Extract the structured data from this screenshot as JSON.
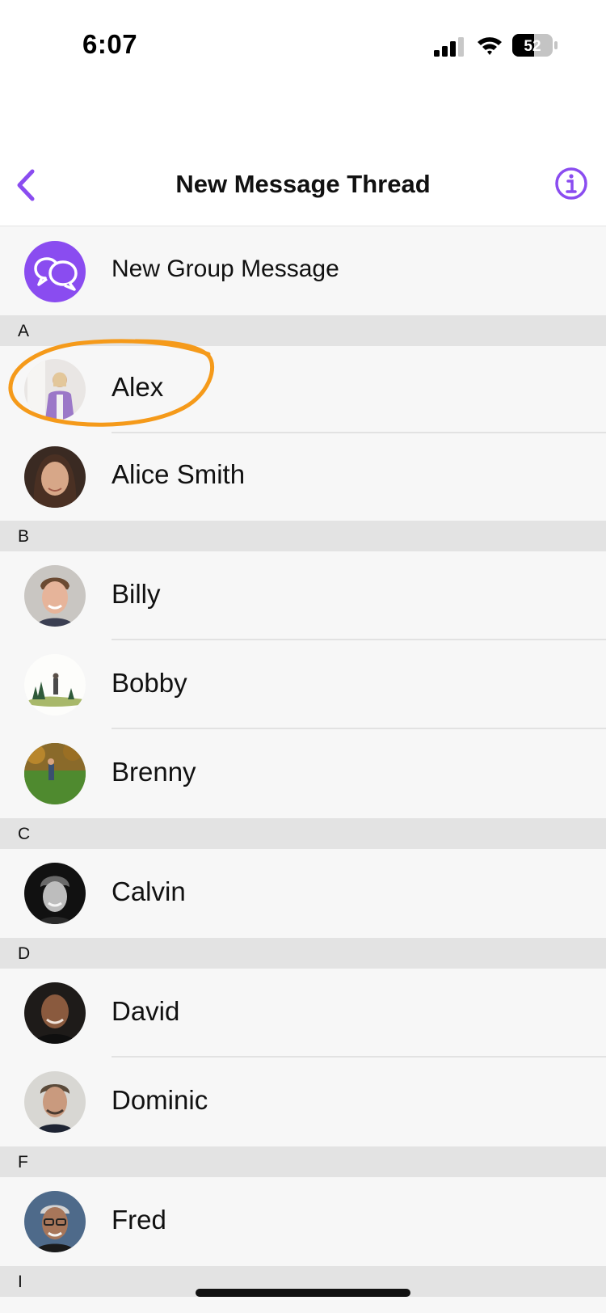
{
  "status_bar": {
    "time": "6:07",
    "battery": "52"
  },
  "nav": {
    "title": "New Message Thread"
  },
  "new_group": {
    "label": "New Group Message"
  },
  "sections": [
    {
      "letter": "A",
      "contacts": [
        "Alex",
        "Alice Smith"
      ]
    },
    {
      "letter": "B",
      "contacts": [
        "Billy",
        "Bobby",
        "Brenny"
      ]
    },
    {
      "letter": "C",
      "contacts": [
        "Calvin"
      ]
    },
    {
      "letter": "D",
      "contacts": [
        "David",
        "Dominic"
      ]
    },
    {
      "letter": "F",
      "contacts": [
        "Fred"
      ]
    },
    {
      "letter": "I",
      "contacts": []
    }
  ],
  "colors": {
    "accent": "#8a4cf0",
    "annotation": "#f59a1a",
    "section_bg": "#e3e3e3",
    "row_bg": "#f7f7f7"
  }
}
